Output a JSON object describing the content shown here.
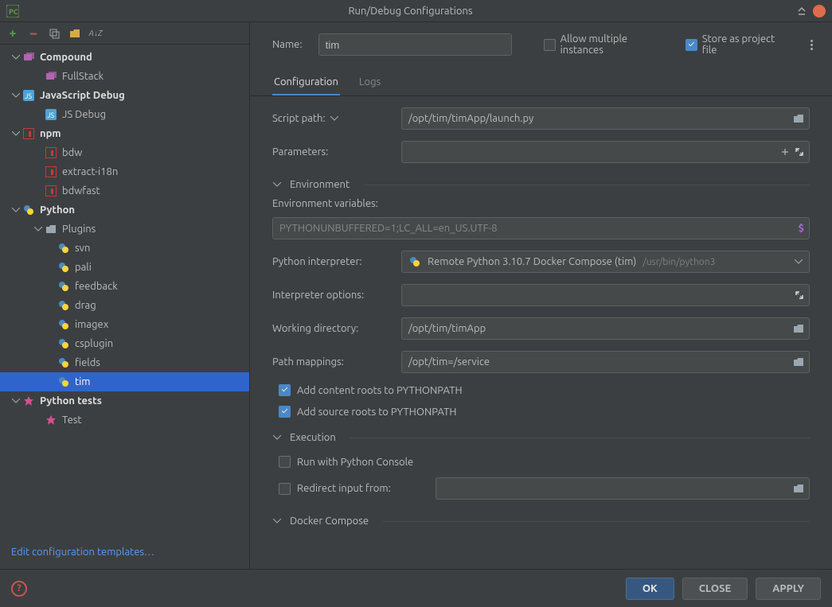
{
  "window": {
    "title": "Run/Debug Configurations"
  },
  "toolbar": {},
  "tree": {
    "compound": {
      "label": "Compound",
      "children": [
        {
          "label": "FullStack",
          "kind": "compound"
        }
      ]
    },
    "jsdebug": {
      "label": "JavaScript Debug",
      "children": [
        {
          "label": "JS Debug",
          "kind": "jsdebug"
        }
      ]
    },
    "npm": {
      "label": "npm",
      "children": [
        {
          "label": "bdw",
          "kind": "npm"
        },
        {
          "label": "extract-i18n",
          "kind": "npm"
        },
        {
          "label": "bdwfast",
          "kind": "npm"
        }
      ]
    },
    "python": {
      "label": "Python",
      "plugins_label": "Plugins",
      "plugins": [
        {
          "label": "svn",
          "kind": "py"
        },
        {
          "label": "pali",
          "kind": "py"
        },
        {
          "label": "feedback",
          "kind": "py"
        },
        {
          "label": "drag",
          "kind": "py"
        },
        {
          "label": "imagex",
          "kind": "py"
        },
        {
          "label": "csplugin",
          "kind": "py"
        },
        {
          "label": "fields",
          "kind": "py"
        },
        {
          "label": "tim",
          "kind": "py",
          "selected": true
        }
      ]
    },
    "pytests": {
      "label": "Python tests",
      "children": [
        {
          "label": "Test",
          "kind": "pytest"
        }
      ]
    }
  },
  "edit_templates": "Edit configuration templates…",
  "form": {
    "name_label": "Name:",
    "name_value": "tim",
    "allow_multiple_label": "Allow multiple instances",
    "allow_multiple_checked": false,
    "store_label": "Store as project file",
    "store_checked": true
  },
  "tabs": {
    "config": "Configuration",
    "logs": "Logs"
  },
  "config": {
    "script_path_label": "Script path:",
    "script_path": "/opt/tim/timApp/launch.py",
    "parameters_label": "Parameters:",
    "parameters": "",
    "env_section": "Environment",
    "env_vars_label": "Environment variables:",
    "env_vars": "PYTHONUNBUFFERED=1;LC_ALL=en_US.UTF-8",
    "interp_label": "Python interpreter:",
    "interp_name": "Remote Python 3.10.7 Docker Compose (tim)",
    "interp_path": "/usr/bin/python3",
    "interp_opts_label": "Interpreter options:",
    "interp_opts": "",
    "workdir_label": "Working directory:",
    "workdir": "/opt/tim/timApp",
    "pathmap_label": "Path mappings:",
    "pathmap": "/opt/tim=/service",
    "add_content_roots": "Add content roots to PYTHONPATH",
    "add_source_roots": "Add source roots to PYTHONPATH",
    "exec_section": "Execution",
    "run_console": "Run with Python Console",
    "redirect_input": "Redirect input from:",
    "docker_section": "Docker Compose"
  },
  "footer": {
    "ok": "OK",
    "close": "CLOSE",
    "apply": "APPLY"
  }
}
